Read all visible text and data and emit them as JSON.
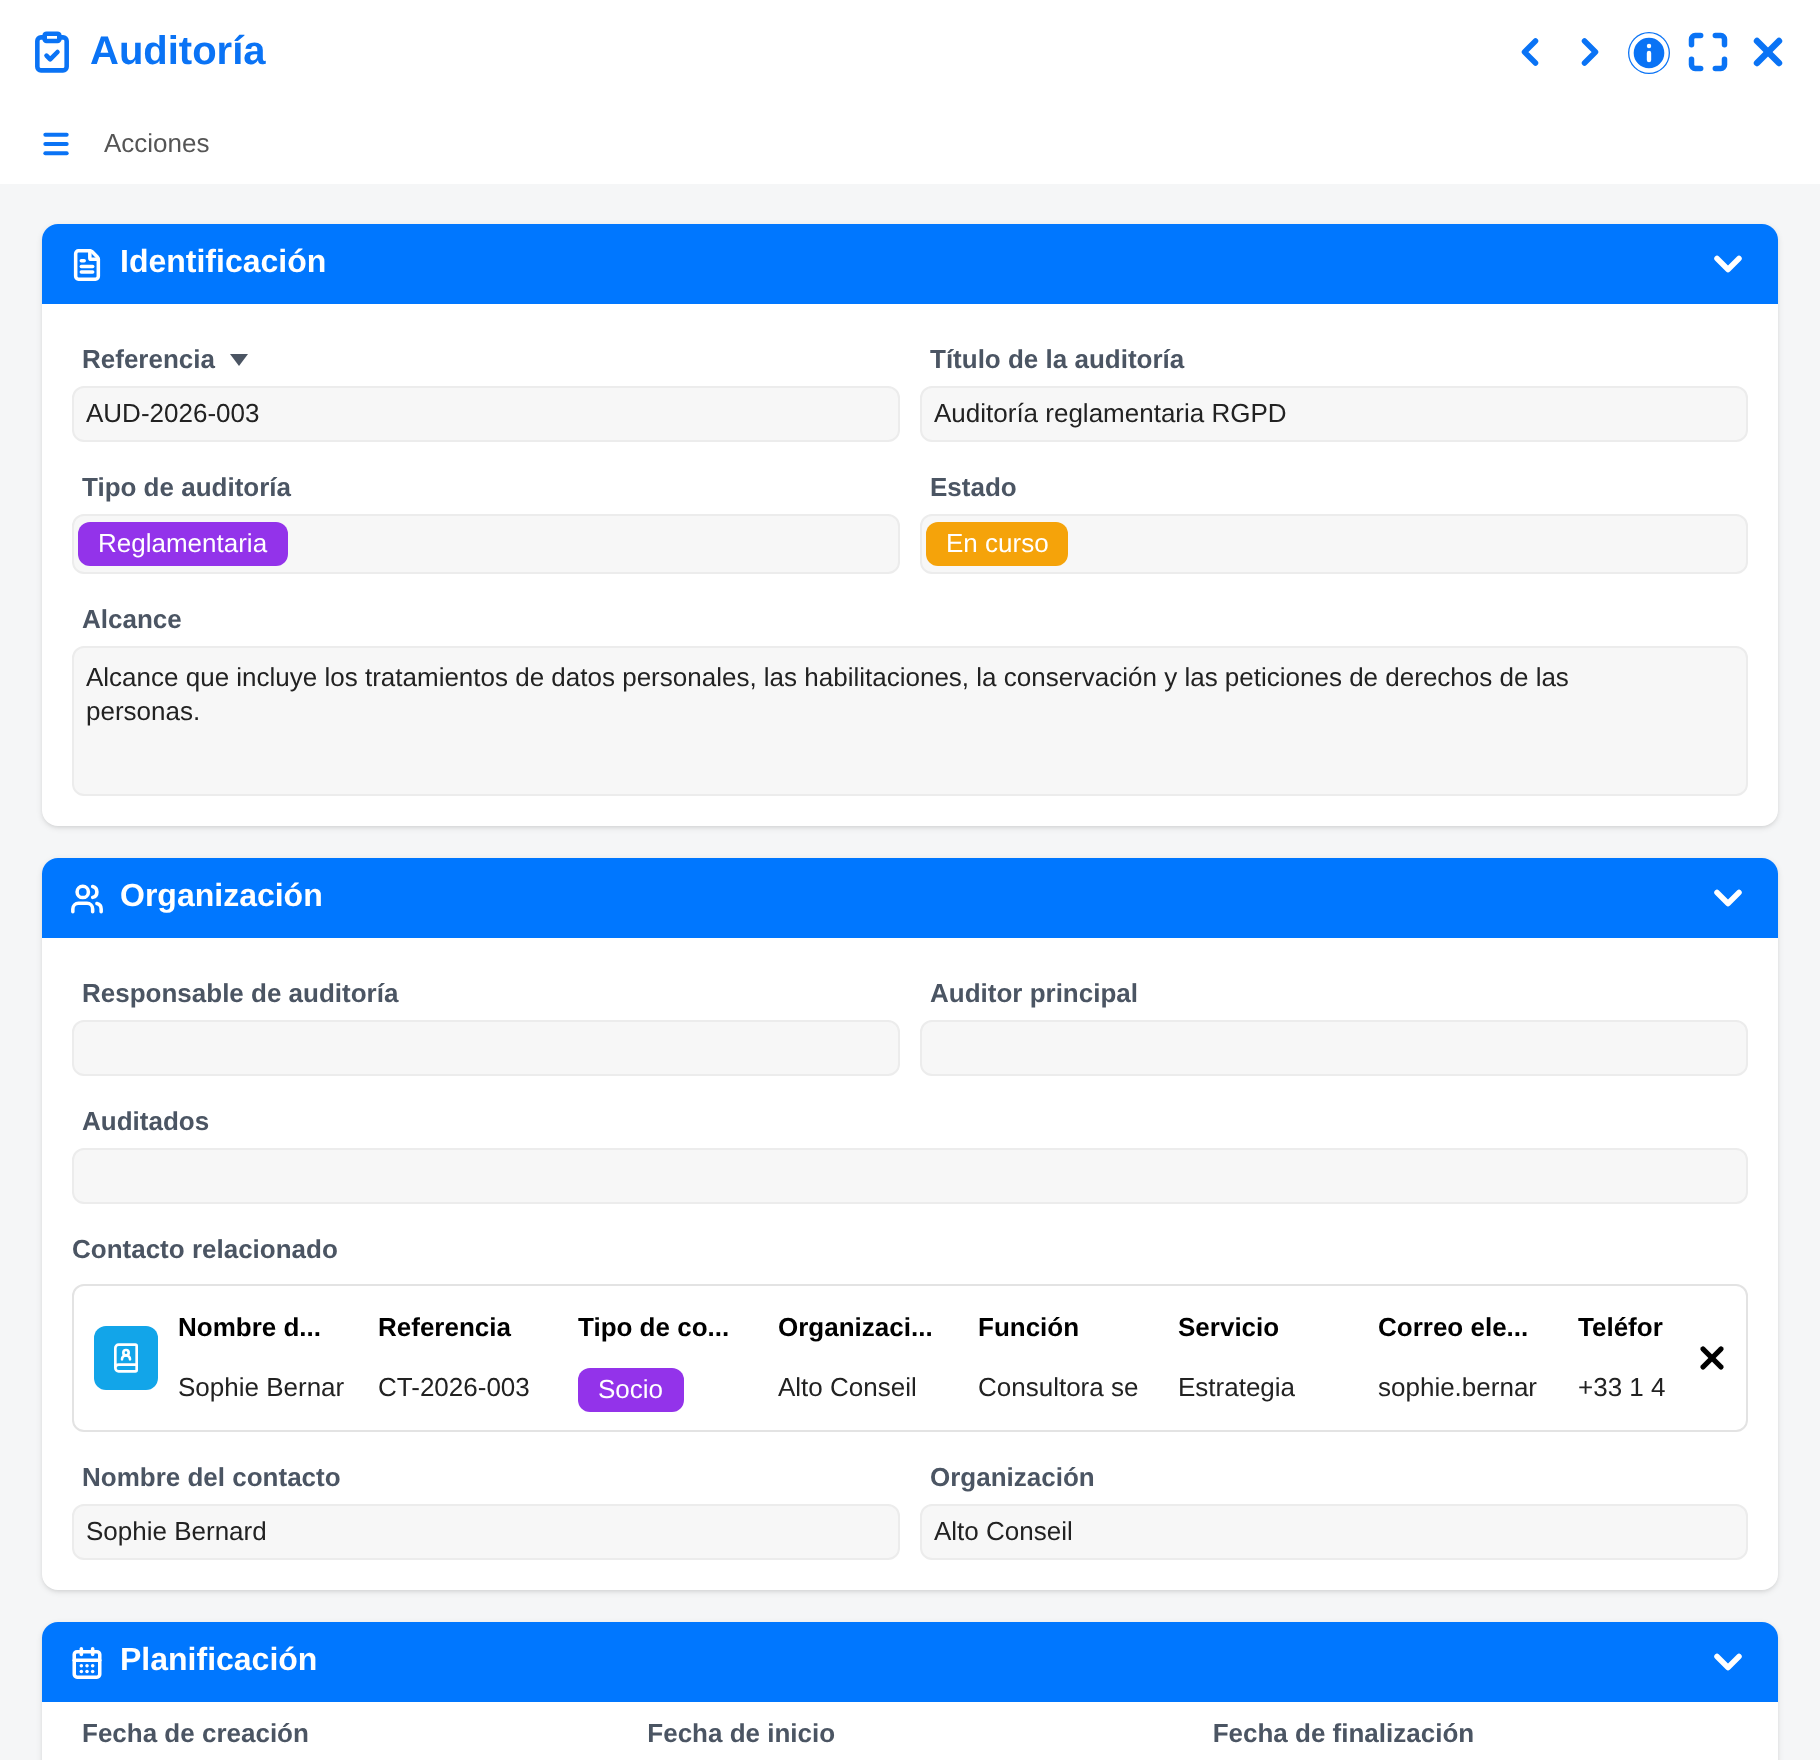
{
  "window": {
    "title": "Auditoría"
  },
  "toolbar": {
    "label": "Acciones"
  },
  "sections": [
    {
      "title": "Identificación",
      "rows": [
        [
          {
            "label": "Referencia",
            "label_caret": true,
            "kind": "text",
            "value": "AUD-2026-003"
          },
          {
            "label": "Título de la auditoría",
            "kind": "text",
            "value": "Auditoría reglamentaria RGPD"
          }
        ],
        [
          {
            "label": "Tipo de auditoría",
            "kind": "badge",
            "value": "Reglamentaria",
            "color": "#9333ea"
          },
          {
            "label": "Estado",
            "kind": "badge",
            "value": "En curso",
            "color": "#f5a30a"
          }
        ],
        [
          {
            "label": "Alcance",
            "kind": "textarea",
            "value": "Alcance que incluye los tratamientos de datos personales, las habilitaciones, la conservación y las peticiones de derechos de las personas."
          }
        ]
      ]
    },
    {
      "title": "Organización",
      "rows": [
        [
          {
            "label": "Responsable de auditoría",
            "kind": "text"
          },
          {
            "label": "Auditor principal",
            "kind": "text"
          }
        ],
        [
          {
            "label": "Auditados",
            "kind": "text"
          }
        ],
        [
          {
            "label": "Contacto relacionado",
            "kind": "contact_table",
            "columns": [
              "Nombre d...",
              "Referencia",
              "Tipo de co...",
              "Organizaci...",
              "Función",
              "Servicio",
              "Correo ele...",
              "Teléfor"
            ],
            "cells": [
              {
                "kind": "text",
                "value": "Sophie Bernar"
              },
              {
                "kind": "text",
                "value": "CT-2026-003"
              },
              {
                "kind": "badge",
                "value": "Socio",
                "color": "#9333ea"
              },
              {
                "kind": "text",
                "value": "Alto Conseil"
              },
              {
                "kind": "text",
                "value": "Consultora se"
              },
              {
                "kind": "text",
                "value": "Estrategia"
              },
              {
                "kind": "text",
                "value": "sophie.bernar"
              },
              {
                "kind": "text",
                "value": "+33 1 4"
              }
            ]
          }
        ],
        [
          {
            "label": "Nombre del contacto",
            "kind": "text",
            "value": "Sophie Bernard"
          },
          {
            "label": "Organización",
            "kind": "text",
            "value": "Alto Conseil"
          }
        ]
      ]
    },
    {
      "title": "Planificación",
      "rows": [
        [
          {
            "label": "Fecha de creación",
            "kind": "text"
          },
          {
            "label": "Fecha de inicio",
            "kind": "text"
          },
          {
            "label": "Fecha de finalización",
            "kind": "text"
          }
        ]
      ]
    }
  ]
}
